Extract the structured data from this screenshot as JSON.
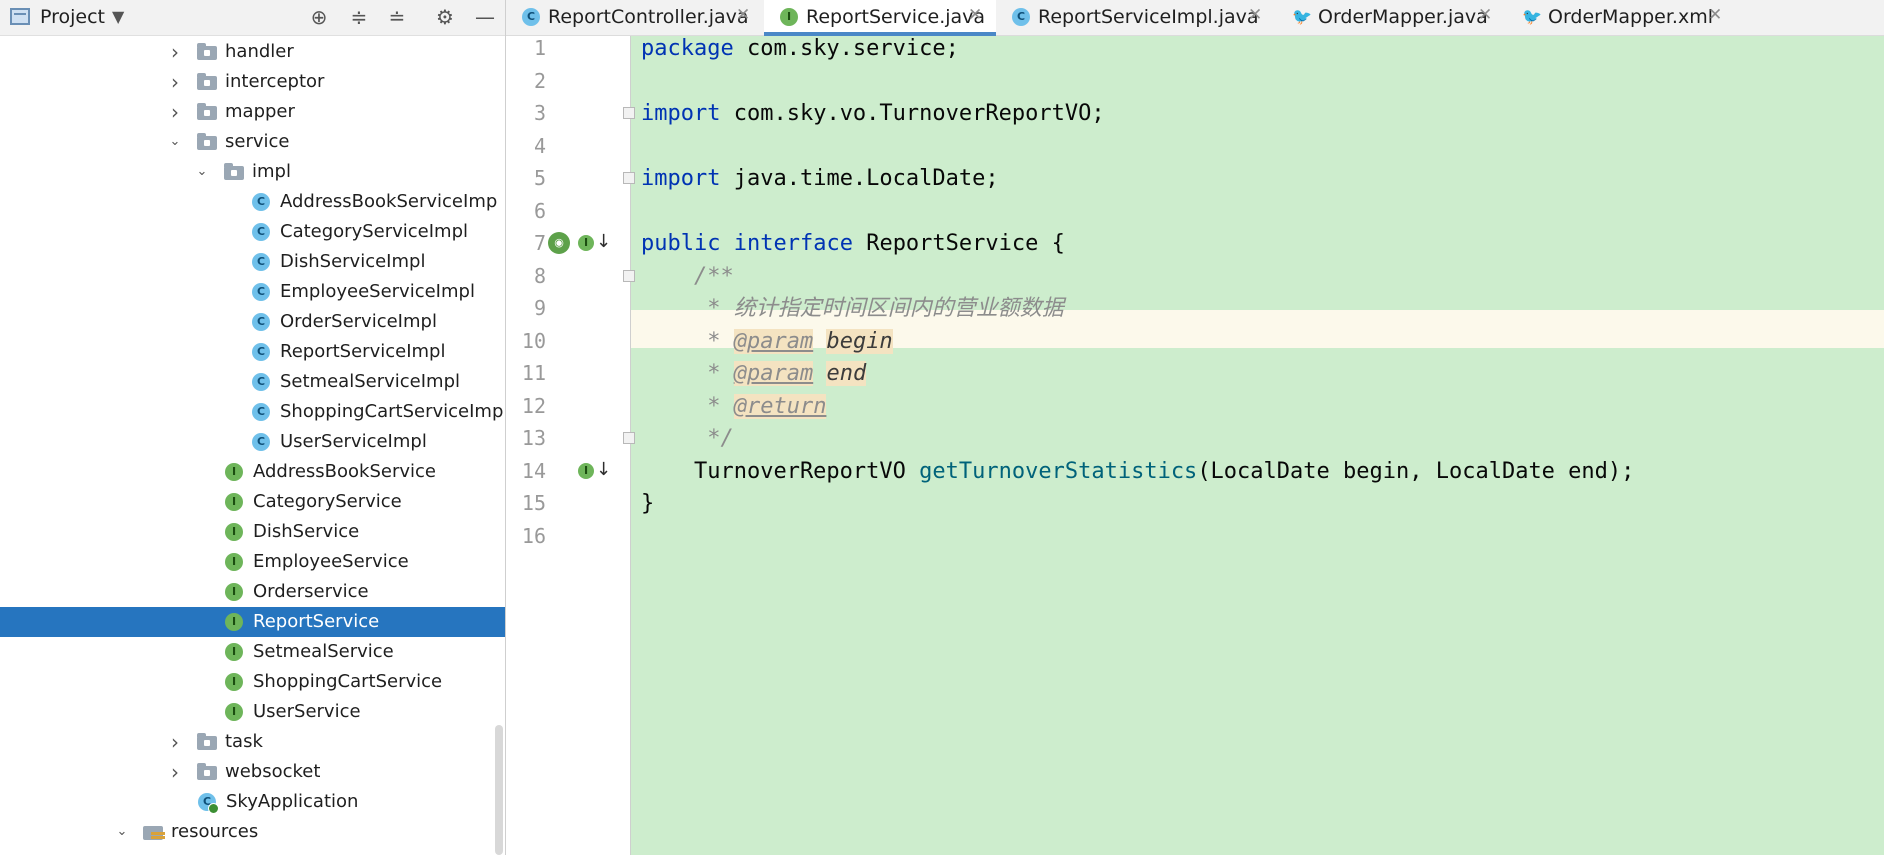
{
  "project_panel": {
    "title": "Project",
    "caret": "▼",
    "toolbar_icons": [
      "locate-icon",
      "expand-all-icon",
      "collapse-all-icon",
      "gear-icon",
      "minimize-icon"
    ]
  },
  "tree": [
    {
      "label": "handler",
      "kind": "folder",
      "expanded": false,
      "selected": false
    },
    {
      "label": "interceptor",
      "kind": "folder",
      "expanded": false,
      "selected": false
    },
    {
      "label": "mapper",
      "kind": "folder",
      "expanded": false,
      "selected": false
    },
    {
      "label": "service",
      "kind": "folder",
      "expanded": true,
      "selected": false
    },
    {
      "label": "impl",
      "kind": "folder",
      "expanded": true,
      "selected": false
    },
    {
      "label": "AddressBookServiceImp",
      "kind": "class",
      "selected": false
    },
    {
      "label": "CategoryServiceImpl",
      "kind": "class",
      "selected": false
    },
    {
      "label": "DishServiceImpl",
      "kind": "class",
      "selected": false
    },
    {
      "label": "EmployeeServiceImpl",
      "kind": "class",
      "selected": false
    },
    {
      "label": "OrderServiceImpl",
      "kind": "class",
      "selected": false
    },
    {
      "label": "ReportServiceImpl",
      "kind": "class",
      "selected": false
    },
    {
      "label": "SetmealServiceImpl",
      "kind": "class",
      "selected": false
    },
    {
      "label": "ShoppingCartServiceImp",
      "kind": "class",
      "selected": false
    },
    {
      "label": "UserServiceImpl",
      "kind": "class",
      "selected": false
    },
    {
      "label": "AddressBookService",
      "kind": "interface",
      "selected": false
    },
    {
      "label": "CategoryService",
      "kind": "interface",
      "selected": false
    },
    {
      "label": "DishService",
      "kind": "interface",
      "selected": false
    },
    {
      "label": "EmployeeService",
      "kind": "interface",
      "selected": false
    },
    {
      "label": "Orderservice",
      "kind": "interface",
      "selected": false
    },
    {
      "label": "ReportService",
      "kind": "interface",
      "selected": true
    },
    {
      "label": "SetmealService",
      "kind": "interface",
      "selected": false
    },
    {
      "label": "ShoppingCartService",
      "kind": "interface",
      "selected": false
    },
    {
      "label": "UserService",
      "kind": "interface",
      "selected": false
    },
    {
      "label": "task",
      "kind": "folder",
      "expanded": false,
      "selected": false
    },
    {
      "label": "websocket",
      "kind": "folder",
      "expanded": false,
      "selected": false
    },
    {
      "label": "SkyApplication",
      "kind": "app",
      "selected": false
    },
    {
      "label": "resources",
      "kind": "resources",
      "expanded": true,
      "selected": false
    }
  ],
  "tabs": [
    {
      "label": "ReportController.java",
      "icon": "class",
      "active": false
    },
    {
      "label": "ReportService.java",
      "icon": "interface",
      "active": true
    },
    {
      "label": "ReportServiceImpl.java",
      "icon": "class",
      "active": false
    },
    {
      "label": "OrderMapper.java",
      "icon": "mybatis",
      "active": false
    },
    {
      "label": "OrderMapper.xml",
      "icon": "mybatis-red",
      "active": false
    }
  ],
  "editor": {
    "current_line": 8,
    "line_numbers": [
      "1",
      "2",
      "3",
      "4",
      "5",
      "6",
      "7",
      "8",
      "9",
      "10",
      "11",
      "12",
      "13",
      "14",
      "15",
      "16"
    ],
    "lines": [
      {
        "n": 1,
        "tokens": [
          {
            "t": "package",
            "c": "kw"
          },
          {
            "t": " com.sky.service;",
            "c": ""
          }
        ]
      },
      {
        "n": 3,
        "tokens": [
          {
            "t": "import",
            "c": "kw"
          },
          {
            "t": " com.sky.vo.TurnoverReportVO;",
            "c": ""
          }
        ]
      },
      {
        "n": 5,
        "tokens": [
          {
            "t": "import",
            "c": "kw"
          },
          {
            "t": " java.time.LocalDate;",
            "c": ""
          }
        ]
      },
      {
        "n": 7,
        "tokens": [
          {
            "t": "public",
            "c": "kw"
          },
          {
            "t": " ",
            "c": ""
          },
          {
            "t": "interface",
            "c": "kw"
          },
          {
            "t": " ReportService {",
            "c": ""
          }
        ]
      },
      {
        "n": 8,
        "tokens": [
          {
            "t": "    /**",
            "c": "cm"
          }
        ]
      },
      {
        "n": 9,
        "tokens": [
          {
            "t": "     * 统计指定时间区间内的营业额数据",
            "c": "cm"
          }
        ]
      },
      {
        "n": 10,
        "tokens": [
          {
            "t": "     * ",
            "c": "cm"
          },
          {
            "t": "@param",
            "c": "tag"
          },
          {
            "t": " ",
            "c": "cm"
          },
          {
            "t": "begin",
            "c": "pv"
          }
        ]
      },
      {
        "n": 11,
        "tokens": [
          {
            "t": "     * ",
            "c": "cm"
          },
          {
            "t": "@param",
            "c": "tag"
          },
          {
            "t": " ",
            "c": "cm"
          },
          {
            "t": "end",
            "c": "pv"
          }
        ]
      },
      {
        "n": 12,
        "tokens": [
          {
            "t": "     * ",
            "c": "cm"
          },
          {
            "t": "@return",
            "c": "tag"
          }
        ]
      },
      {
        "n": 13,
        "tokens": [
          {
            "t": "     */",
            "c": "cm"
          }
        ]
      },
      {
        "n": 14,
        "tokens": [
          {
            "t": "    TurnoverReportVO ",
            "c": ""
          },
          {
            "t": "getTurnoverStatistics",
            "c": "fn"
          },
          {
            "t": "(LocalDate begin, LocalDate end);",
            "c": ""
          }
        ]
      },
      {
        "n": 15,
        "tokens": [
          {
            "t": "}",
            "c": ""
          }
        ]
      }
    ],
    "fold_markers": [
      3,
      5,
      8,
      13
    ],
    "gutter_markers": [
      {
        "line": 7,
        "icons": [
          "implemented-by-icon",
          "interface-icon",
          "down-arrow-icon"
        ]
      },
      {
        "line": 14,
        "icons": [
          "interface-icon",
          "down-arrow-icon"
        ]
      }
    ]
  },
  "colors": {
    "editor_bg": "#cdedcd",
    "selection": "#2675bf",
    "keyword": "#0033b3",
    "method": "#00627a",
    "comment": "#8c8c8c"
  }
}
